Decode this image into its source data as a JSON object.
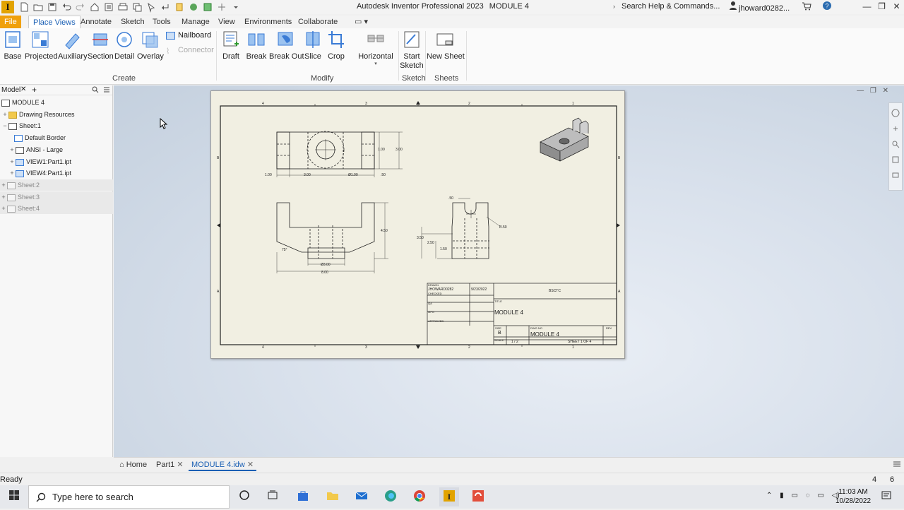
{
  "window": {
    "app_logo": "I",
    "title_app": "Autodesk Inventor Professional 2023",
    "title_doc": "MODULE 4",
    "search_placeholder": "Search Help & Commands...",
    "user": "jhoward0282...",
    "controls": [
      "—",
      "❐",
      "✕"
    ]
  },
  "ribbon_tabs": [
    "File",
    "Place Views",
    "Annotate",
    "Sketch",
    "Tools",
    "Manage",
    "View",
    "Environments",
    "Collaborate"
  ],
  "ribbon": {
    "create": {
      "label": "Create",
      "buttons": [
        "Base",
        "Projected",
        "Auxiliary",
        "Section",
        "Detail",
        "Overlay"
      ],
      "small": [
        "Nailboard",
        "Connector"
      ]
    },
    "modify": {
      "label": "Modify",
      "buttons": [
        "Draft",
        "Break",
        "Break Out",
        "Slice",
        "Crop",
        "Horizontal"
      ]
    },
    "sketch": {
      "label": "Sketch",
      "buttons": [
        "Start Sketch"
      ]
    },
    "sheets": {
      "label": "Sheets",
      "buttons": [
        "New Sheet"
      ]
    }
  },
  "browser": {
    "tab": "Model",
    "items": [
      {
        "label": "MODULE 4"
      },
      {
        "label": "Drawing Resources"
      },
      {
        "label": "Sheet:1"
      },
      {
        "label": "Default Border"
      },
      {
        "label": "ANSI - Large"
      },
      {
        "label": "VIEW1:Part1.ipt"
      },
      {
        "label": "VIEW4:Part1.ipt"
      },
      {
        "label": "Sheet:2"
      },
      {
        "label": "Sheet:3"
      },
      {
        "label": "Sheet:4"
      }
    ]
  },
  "drawing": {
    "zone_numbers": [
      "4",
      "3",
      "2",
      "1"
    ],
    "zone_letters": [
      "B",
      "A"
    ],
    "dimensions": {
      "top_a": "1.00",
      "top_b": "3.00",
      "top_c": "1.00",
      "top_d": "3.00",
      "top_e": "Ø1.00",
      "top_f": ".50",
      "front_a": "4.50",
      "front_b": "75°",
      "front_c": "Ø3.00",
      "front_d": "8.00",
      "side_a": ".50",
      "side_b": "R.50",
      "side_c": "3.50",
      "side_d": "2.50",
      "side_e": "1.50"
    },
    "title_block": {
      "drawn_label": "DRAWN",
      "drawn_by": "JHOWARD0282",
      "drawn_date": "9/23/2022",
      "checked": "CHECKED",
      "qa": "QA",
      "mfg": "MFG",
      "approved": "APPROVED",
      "company": "BSCTC",
      "title_label": "TITLE",
      "title": "MODULE 4",
      "size_label": "SIZE",
      "size": "B",
      "dwg_label": "DWG NO",
      "dwg_no": "MODULE 4",
      "rev_label": "REV",
      "scale_label": "SCALE",
      "scale": "1 / 2",
      "sheet": "SHEET 1 OF 4"
    }
  },
  "doc_tabs": [
    "Home",
    "Part1",
    "MODULE 4.idw"
  ],
  "status": {
    "text": "Ready",
    "n1": "4",
    "n2": "6"
  },
  "taskbar": {
    "search_placeholder": "Type here to search",
    "time": "11:03 AM",
    "date": "10/28/2022"
  }
}
